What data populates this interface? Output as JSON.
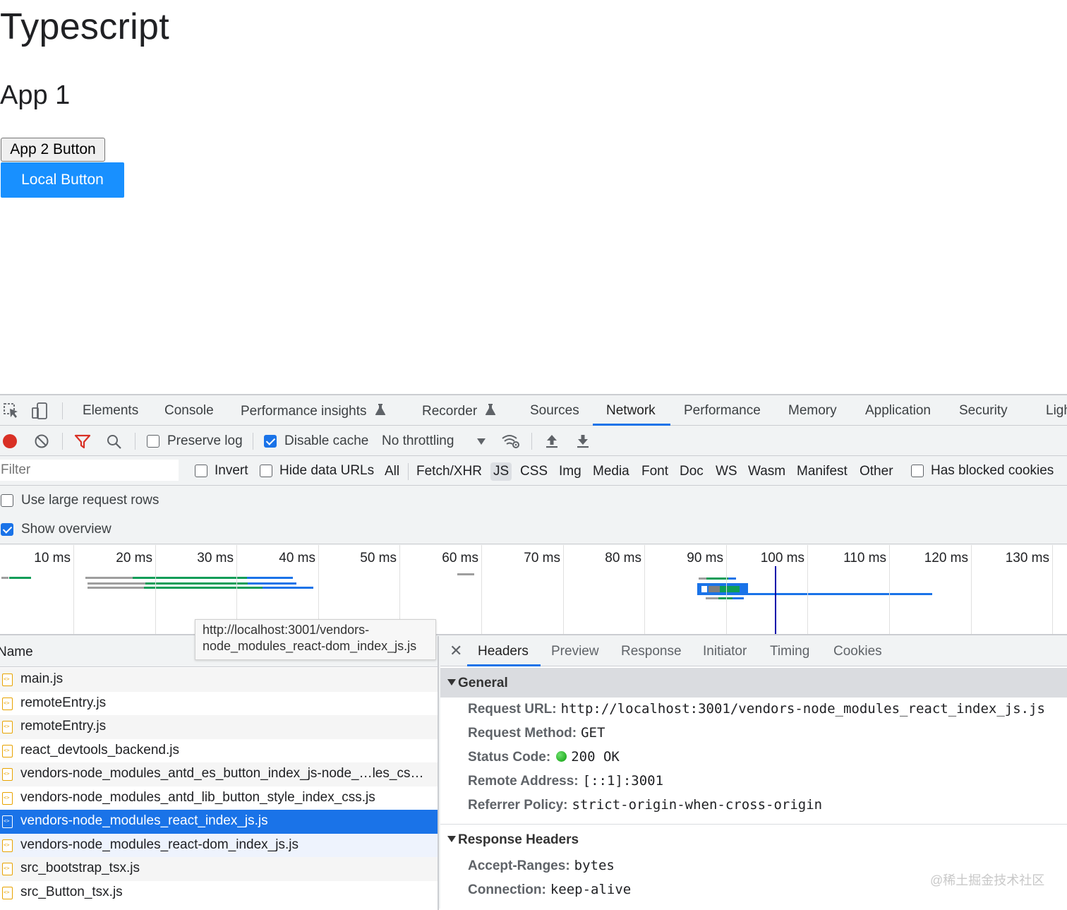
{
  "page": {
    "title": "Typescript",
    "app_title": "App 1",
    "app2_button": "App 2 Button",
    "local_button": "Local Button",
    "local_button_color": "#1890ff"
  },
  "devtools": {
    "tabs": [
      "Elements",
      "Console",
      "Performance insights",
      "Recorder",
      "Sources",
      "Network",
      "Performance",
      "Memory",
      "Application",
      "Security",
      "Ligh"
    ],
    "active_tab": "Network",
    "toolbar": {
      "preserve_log": "Preserve log",
      "preserve_log_checked": false,
      "disable_cache": "Disable cache",
      "disable_cache_checked": true,
      "throttling": "No throttling"
    },
    "filter": {
      "placeholder": "Filter",
      "invert": "Invert",
      "hide_data_urls": "Hide data URLs",
      "types": [
        "All",
        "Fetch/XHR",
        "JS",
        "CSS",
        "Img",
        "Media",
        "Font",
        "Doc",
        "WS",
        "Wasm",
        "Manifest",
        "Other"
      ],
      "active_type": "JS",
      "has_blocked_cookies": "Has blocked cookies"
    },
    "options": {
      "large_rows": "Use large request rows",
      "large_rows_checked": false,
      "show_overview": "Show overview",
      "show_overview_checked": true
    },
    "overview": {
      "ticks": [
        "10 ms",
        "20 ms",
        "30 ms",
        "40 ms",
        "50 ms",
        "60 ms",
        "70 ms",
        "80 ms",
        "90 ms",
        "100 ms",
        "110 ms",
        "120 ms",
        "130 ms"
      ],
      "colors": {
        "waiting": "#0f9d58",
        "download": "#1a73e8",
        "queue": "#9e9e9e",
        "marker": "#0000aa"
      }
    },
    "requests": {
      "header": "Name",
      "items": [
        "main.js",
        "remoteEntry.js",
        "remoteEntry.js",
        "react_devtools_backend.js",
        "vendors-node_modules_antd_es_button_index_js-node_…les_cs…",
        "vendors-node_modules_antd_lib_button_style_index_css.js",
        "vendors-node_modules_react_index_js.js",
        "vendors-node_modules_react-dom_index_js.js",
        "src_bootstrap_tsx.js",
        "src_Button_tsx.js"
      ],
      "selected_index": 6,
      "tooltip_line1": "http://localhost:3001/vendors-",
      "tooltip_line2": "node_modules_react-dom_index_js.js"
    },
    "detail": {
      "tabs": [
        "Headers",
        "Preview",
        "Response",
        "Initiator",
        "Timing",
        "Cookies"
      ],
      "active_tab": "Headers",
      "general": {
        "title": "General",
        "request_url_label": "Request URL:",
        "request_url": "http://localhost:3001/vendors-node_modules_react_index_js.js",
        "request_method_label": "Request Method:",
        "request_method": "GET",
        "status_code_label": "Status Code:",
        "status_code": "200 OK",
        "remote_address_label": "Remote Address:",
        "remote_address": "[::1]:3001",
        "referrer_policy_label": "Referrer Policy:",
        "referrer_policy": "strict-origin-when-cross-origin"
      },
      "response_headers": {
        "title": "Response Headers",
        "accept_ranges_label": "Accept-Ranges:",
        "accept_ranges": "bytes",
        "connection_label": "Connection:",
        "connection": "keep-alive"
      }
    }
  },
  "watermark": "@稀土掘金技术社区"
}
